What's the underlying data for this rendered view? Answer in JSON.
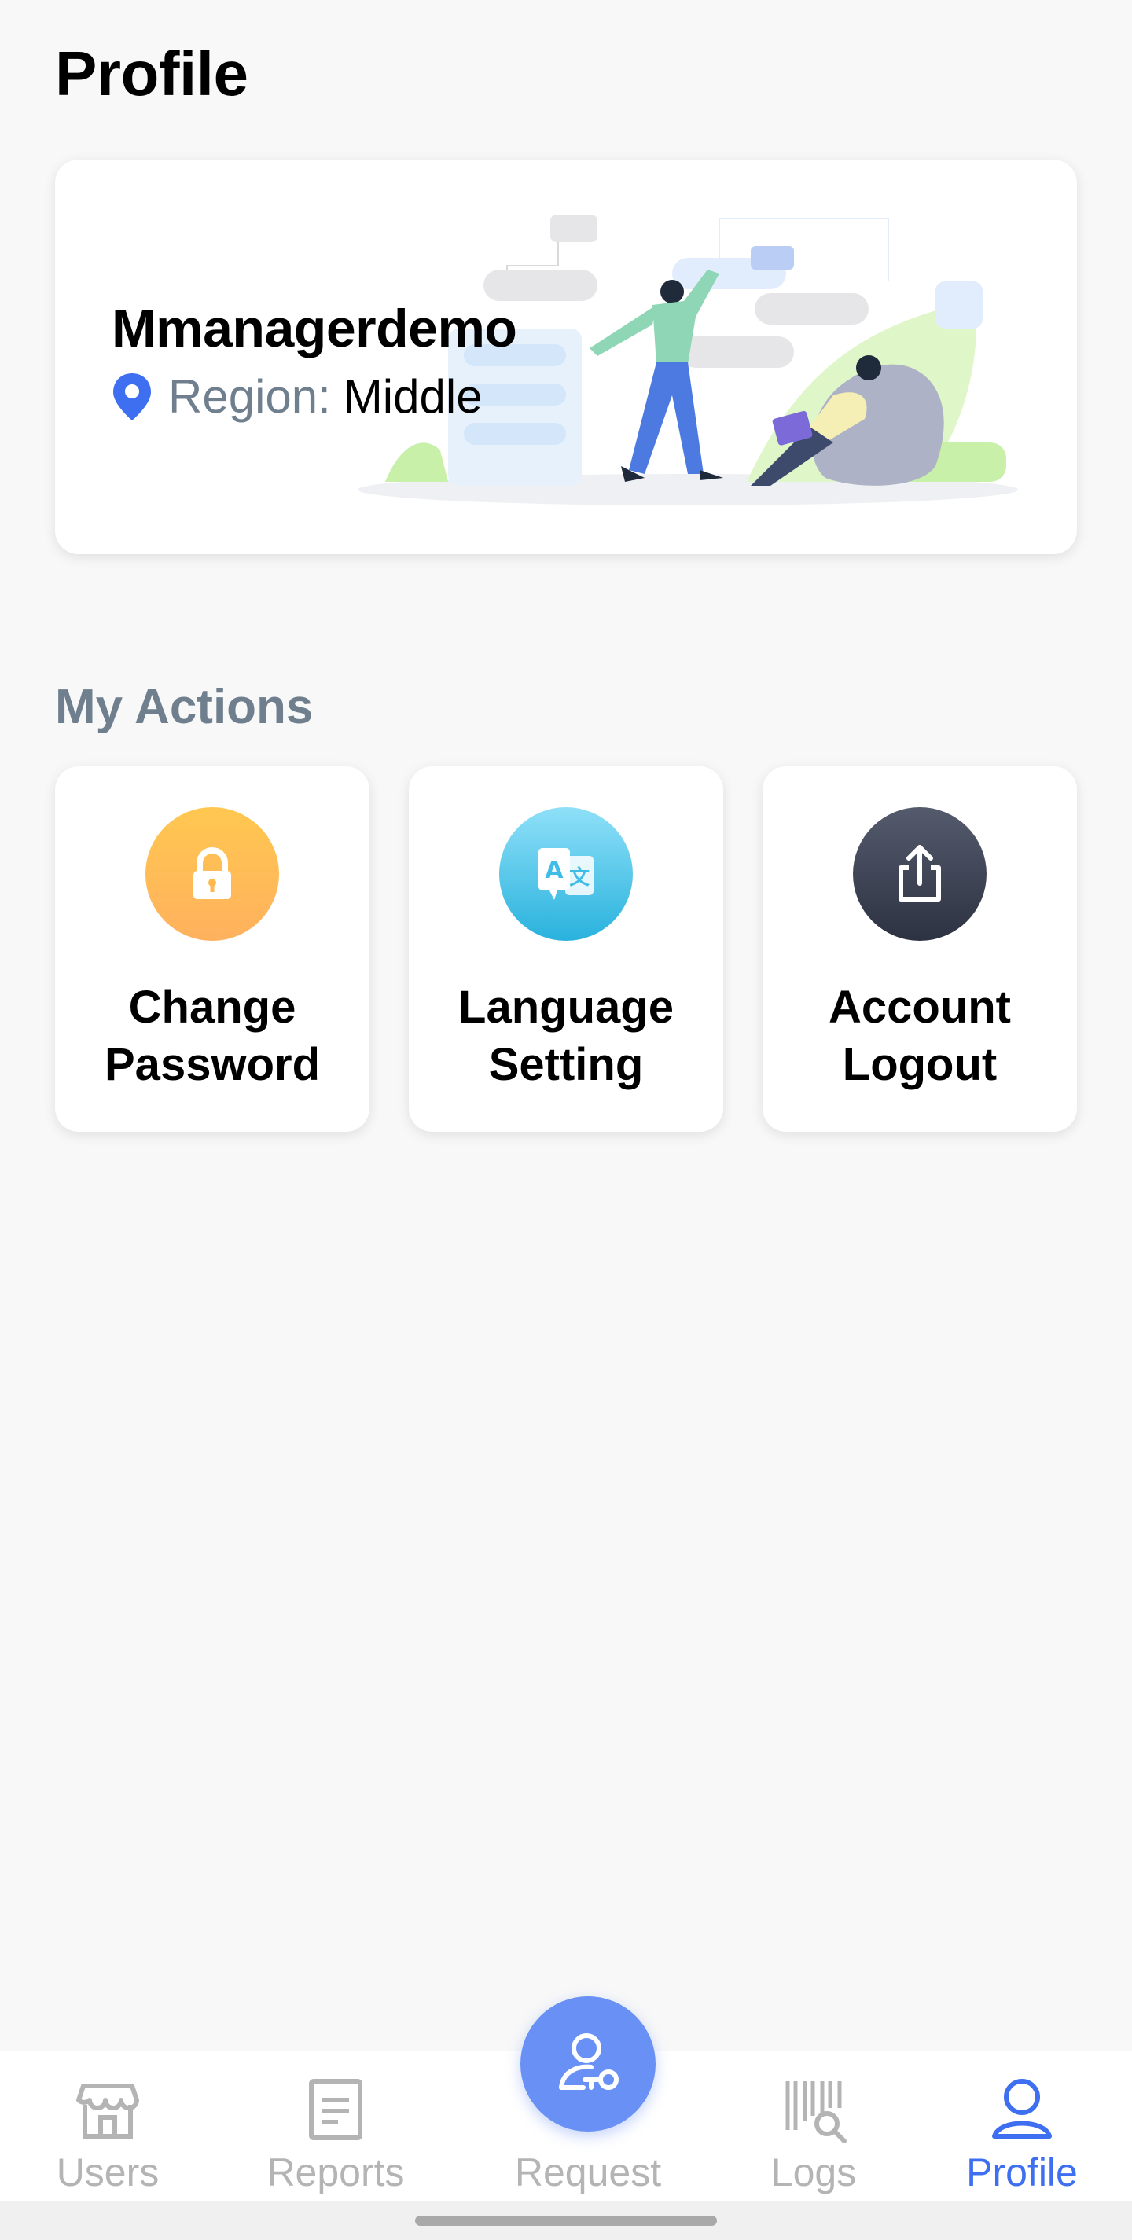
{
  "header": {
    "title": "Profile"
  },
  "profile": {
    "name": "Mmanagerdemo",
    "region_label": "Region:",
    "region_value": "Middle"
  },
  "actions": {
    "title": "My Actions",
    "items": [
      {
        "label": "Change\nPassword",
        "icon": "lock-icon",
        "color": "#ffb84d"
      },
      {
        "label": "Language\nSetting",
        "icon": "translate-icon",
        "color": "#3fbde6"
      },
      {
        "label": "Account\nLogout",
        "icon": "share-logout-icon",
        "color": "#3d4455"
      }
    ]
  },
  "tabbar": {
    "items": [
      {
        "label": "Users",
        "icon": "store-icon",
        "active": false
      },
      {
        "label": "Reports",
        "icon": "document-icon",
        "active": false
      },
      {
        "label": "Request",
        "icon": "user-key-icon",
        "active": false
      },
      {
        "label": "Logs",
        "icon": "barcode-search-icon",
        "active": false
      },
      {
        "label": "Profile",
        "icon": "user-icon",
        "active": true
      }
    ],
    "active_color": "#3e6ff0",
    "inactive_color": "#b4b4b4"
  }
}
